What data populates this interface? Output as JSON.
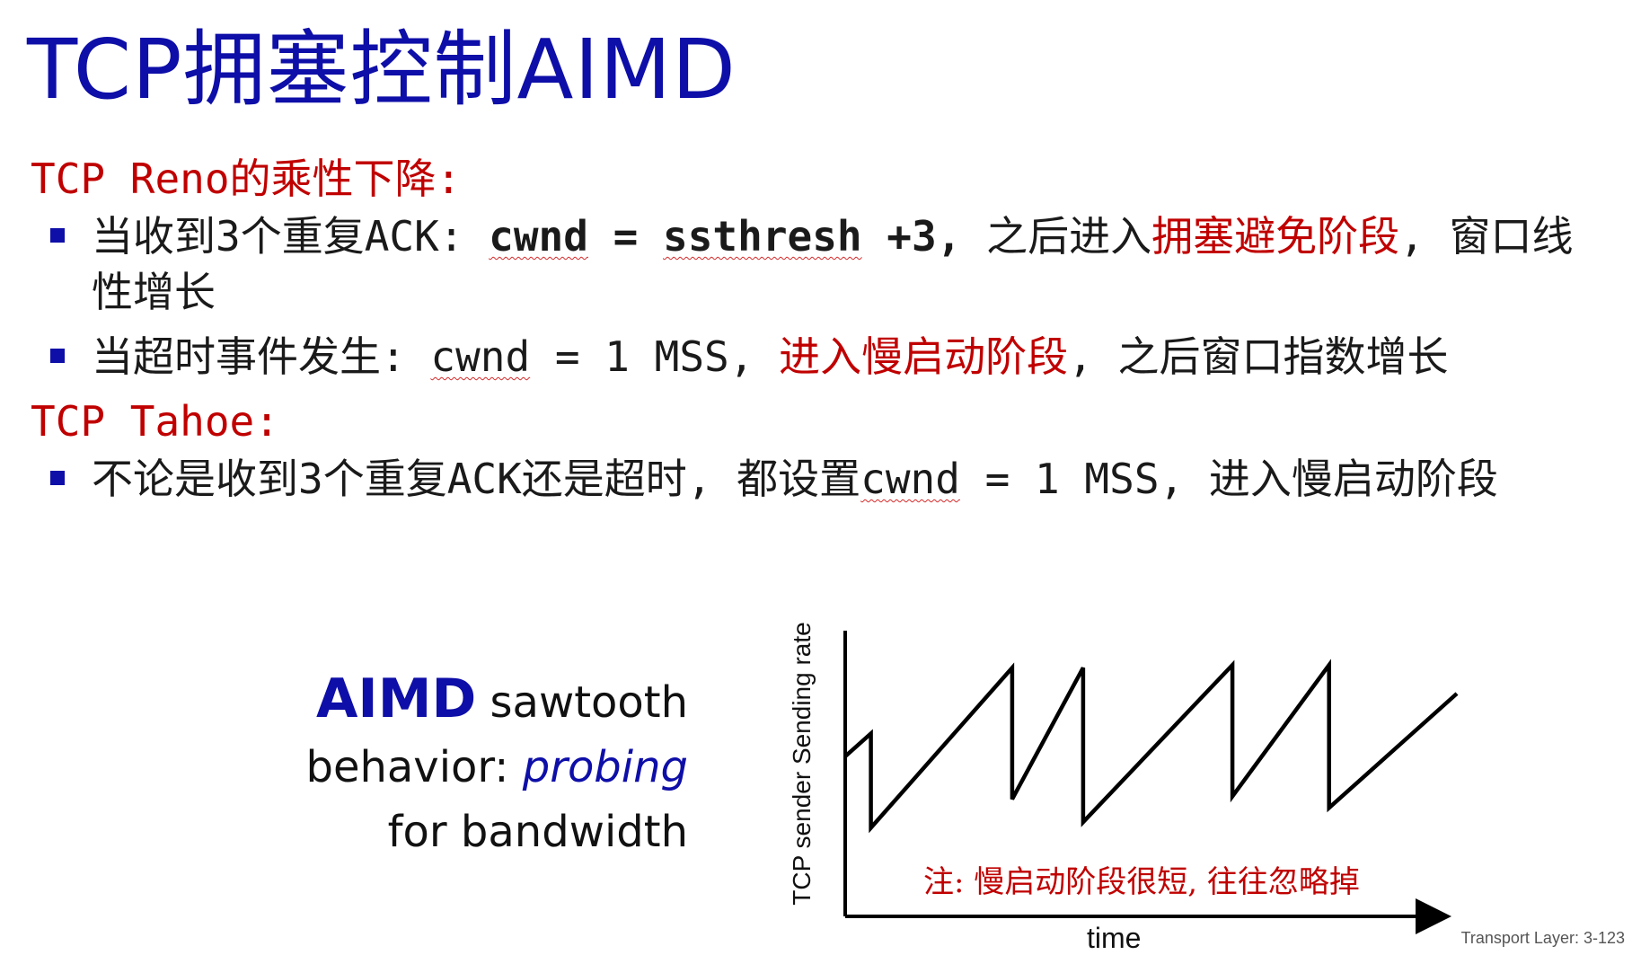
{
  "title": "TCP拥塞控制AIMD",
  "reno": {
    "heading": "TCP Reno的乘性下降:",
    "item1": {
      "t1": "当收到3个重复ACK: ",
      "cwnd": "cwnd",
      "eq": " = ",
      "ssthresh": "ssthresh",
      "plus": " +3,",
      "t2": " 之后进入",
      "red": "拥塞避免阶段",
      "t3": ", 窗口线性增长"
    },
    "item2": {
      "t1": "当超时事件发生: ",
      "cwnd": "cwnd",
      "t2": " = 1 MSS, ",
      "red": "进入慢启动阶段",
      "t3": ", 之后窗口指数增长"
    }
  },
  "tahoe": {
    "heading": "TCP Tahoe:",
    "item1": {
      "t1": "不论是收到3个重复ACK还是超时, 都设置",
      "cwnd": "cwnd",
      "t2": " = 1 MSS, 进入慢启动阶段"
    }
  },
  "caption": {
    "aimd": "AIMD",
    "line1_rest": " sawtooth",
    "line2_a": "behavior: ",
    "line2_b": "probing",
    "line3": "for bandwidth"
  },
  "chart_data": {
    "type": "line",
    "title": "",
    "xlabel": "time",
    "ylabel": "TCP sender  Sending rate",
    "note": "注: 慢启动阶段很短, 往往忽略掉",
    "series": [
      {
        "x": [
          0,
          4.2,
          4.2,
          27.3,
          27.3,
          38.9,
          38.9,
          63.3,
          63.3,
          79.1,
          79.1,
          100
        ],
        "y": [
          56,
          64,
          31,
          87,
          41,
          87,
          33,
          88,
          42,
          88,
          38,
          78
        ]
      }
    ],
    "xlim": [
      0,
      100
    ],
    "ylim": [
      0,
      100
    ]
  },
  "footer": "Transport Layer: 3-123",
  "colors": {
    "title": "#0e0ea8",
    "accent_red": "#c00000"
  }
}
